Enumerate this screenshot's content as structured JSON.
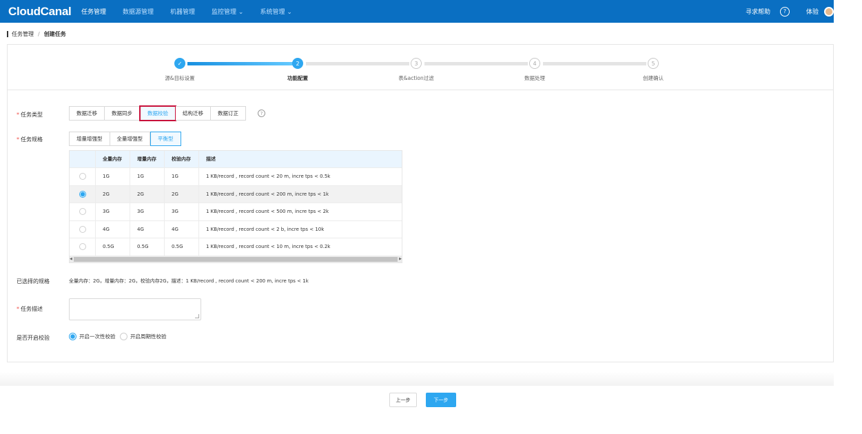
{
  "header": {
    "logo": "CloudCanal",
    "nav": [
      "任务管理",
      "数据源管理",
      "机器管理",
      "监控管理 ⌄",
      "系统管理 ⌄"
    ],
    "help": "寻求帮助",
    "help_icon": "?",
    "user": "体验"
  },
  "breadcrumb": {
    "parent": "任务管理",
    "separator": "/",
    "current": "创建任务"
  },
  "steps": {
    "items": [
      {
        "num": "✓",
        "label": "源&目标设置",
        "state": "done"
      },
      {
        "num": "2",
        "label": "功能配置",
        "state": "active"
      },
      {
        "num": "3",
        "label": "表&action过滤",
        "state": "todo"
      },
      {
        "num": "4",
        "label": "数据处理",
        "state": "todo"
      },
      {
        "num": "5",
        "label": "创建确认",
        "state": "todo"
      }
    ]
  },
  "form": {
    "task_type": {
      "label": "任务类型",
      "options": [
        "数据迁移",
        "数据同步",
        "数据校验",
        "结构迁移",
        "数据订正"
      ],
      "selected": "数据校验",
      "help_icon": "?"
    },
    "task_spec": {
      "label": "任务规格",
      "options": [
        "增量增强型",
        "全量增强型",
        "平衡型"
      ],
      "selected": "平衡型"
    },
    "spec_table": {
      "headers": [
        "",
        "全量内存",
        "增量内存",
        "校验内存",
        "描述"
      ],
      "rows": [
        {
          "full": "1G",
          "incr": "1G",
          "check": "1G",
          "desc": "1 KB/record , record count < 20 m, incre tps < 0.5k",
          "selected": false
        },
        {
          "full": "2G",
          "incr": "2G",
          "check": "2G",
          "desc": "1 KB/record , record count < 200 m, incre tps < 1k",
          "selected": true
        },
        {
          "full": "3G",
          "incr": "3G",
          "check": "3G",
          "desc": "1 KB/record , record count < 500 m, incre tps < 2k",
          "selected": false
        },
        {
          "full": "4G",
          "incr": "4G",
          "check": "4G",
          "desc": "1 KB/record , record count < 2 b, incre tps < 10k",
          "selected": false
        },
        {
          "full": "0.5G",
          "incr": "0.5G",
          "check": "0.5G",
          "desc": "1 KB/record , record count < 10 m, incre tps < 0.2k",
          "selected": false
        }
      ],
      "scroll_left": "◀",
      "scroll_right": "▶"
    },
    "selected_spec": {
      "label": "已选择的规格",
      "value": "全量内存：2G，增量内存：2G，校验内存2G，描述：1 KB/record , record count < 200 m, incre tps < 1k"
    },
    "task_desc": {
      "label": "任务描述",
      "value": ""
    },
    "verify": {
      "label": "是否开启校验",
      "options": [
        "开启一次性校验",
        "开启周期性校验"
      ],
      "selected": "开启一次性校验"
    },
    "required_mark": "*"
  },
  "footer": {
    "prev": "上一步",
    "next": "下一步"
  },
  "colors": {
    "nav_bg": "#0a6fc2",
    "accent": "#2ea7f0",
    "highlight": "#c8103a",
    "required": "#f0504a"
  }
}
